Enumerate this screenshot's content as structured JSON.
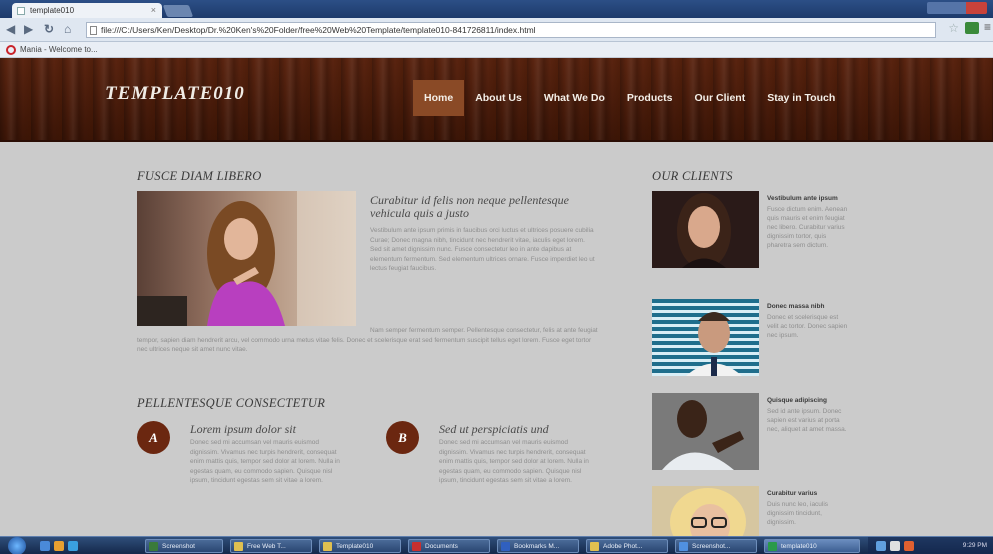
{
  "browser": {
    "tab_title": "template010",
    "url": "file:///C:/Users/Ken/Desktop/Dr.%20Ken's%20Folder/free%20Web%20Template/template010-841726811/index.html",
    "bookmark": "Mania - Welcome to..."
  },
  "site": {
    "logo": "TEMPLATE010",
    "nav": [
      "Home",
      "About Us",
      "What We Do",
      "Products",
      "Our Client",
      "Stay in Touch"
    ]
  },
  "main": {
    "section1_heading": "FUSCE DIAM LIBERO",
    "feature_title": "Curabitur id felis non neque pellentesque vehicula quis a justo",
    "feature_text": "Vestibulum ante ipsum primis in faucibus orci luctus et ultrices posuere cubilia Curae; Donec magna nibh, tincidunt nec hendrerit vitae, iaculis eget lorem. Sed sit amet dignissim nunc. Fusce consectetur leo in ante dapibus at elementum fermentum. Sed elementum ultrices ornare. Fusce imperdiet leo ut lectus feugiat faucibus.",
    "feature_text2": "Nam semper fermentum semper. Pellentesque consectetur, felis at ante feugiat tempor, sapien diam hendrerit arcu, vel commodo urna metus vitae felis. Donec et scelerisque erat sed fermentum suscipit tellus eget lorem. Fusce eget tortor nec ultrices neque sit amet nunc vitae.",
    "section2_heading": "PELLENTESQUE CONSECTETUR",
    "col_a": {
      "badge": "A",
      "title": "Lorem ipsum dolor sit",
      "text": "Donec sed mi accumsan vel mauris euismod dignissim. Vivamus nec turpis hendrerit, consequat enim mattis quis, tempor sed dolor at lorem. Nulla in egestas quam, eu commodo sapien. Quisque nisl ipsum, tincidunt egestas sem sit vitae a lorem."
    },
    "col_b": {
      "badge": "B",
      "title": "Sed ut perspiciatis und",
      "text": "Donec sed mi accumsan vel mauris euismod dignissim. Vivamus nec turpis hendrerit, consequat enim mattis quis, tempor sed dolor at lorem. Nulla in egestas quam, eu commodo sapien. Quisque nisl ipsum, tincidunt egestas sem sit vitae a lorem."
    }
  },
  "clients": {
    "heading": "OUR CLIENTS",
    "items": [
      {
        "name": "Vestibulum ante ipsum",
        "text": "Fusce dictum enim. Aenean quis mauris et enim feugiat nec libero. Curabitur varius dignissim tortor, quis pharetra sem dictum."
      },
      {
        "name": "Donec massa nibh",
        "text": "Donec et scelerisque est velit ac tortor. Donec sapien nec ipsum."
      },
      {
        "name": "Quisque adipiscing",
        "text": "Sed id ante ipsum. Donec sapien est varius at porta nec, aliquet at amet massa."
      },
      {
        "name": "Curabitur varius",
        "text": "Duis nunc leo, iaculis dignissim tincidunt, dignissim."
      }
    ]
  },
  "taskbar": {
    "buttons": [
      "Screenshot",
      "Free Web T...",
      "Template010",
      "Documents",
      "Bookmarks M...",
      "Adobe Phot...",
      "Screenshot...",
      "template010"
    ],
    "clock": "9:29 PM"
  }
}
